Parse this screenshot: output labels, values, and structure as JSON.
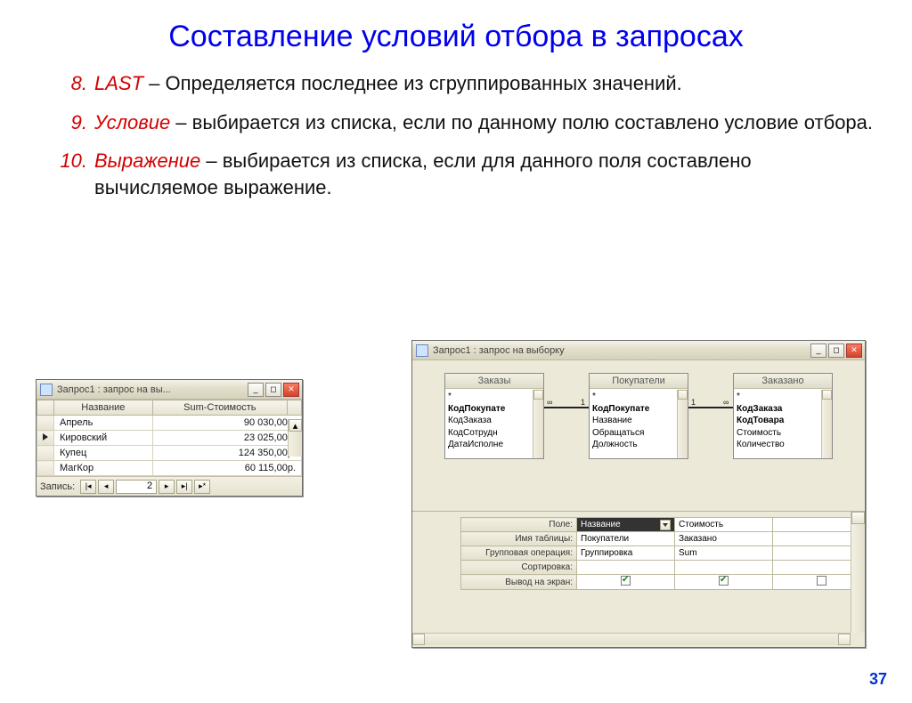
{
  "slide": {
    "title": "Составление условий отбора в запросах",
    "page_number": "37",
    "bullets": [
      {
        "num": "8.",
        "head": "LAST",
        "text": " –  Определяется последнее из сгруппированных значений."
      },
      {
        "num": "9.",
        "head": "Условие",
        "text": " – выбирается из списка, если по данному полю составлено условие отбора."
      },
      {
        "num": "10.",
        "head": "Выражение",
        "text": "  – выбирается из списка, если для данного поля составлено вычисляемое выражение."
      }
    ]
  },
  "datasheet": {
    "title": "Запрос1 : запрос на вы...",
    "columns": [
      "Название",
      "Sum-Стоимость"
    ],
    "rows": [
      {
        "name": "Апрель",
        "sum": "90 030,00р."
      },
      {
        "name": "Кировский",
        "sum": "23 025,00р."
      },
      {
        "name": "Купец",
        "sum": "124 350,00р."
      },
      {
        "name": "МагКор",
        "sum": "60 115,00р."
      }
    ],
    "nav": {
      "label": "Запись:",
      "current": "2"
    }
  },
  "design": {
    "title": "Запрос1 : запрос на выборку",
    "tables": {
      "orders": {
        "title": "Заказы",
        "fields": [
          "*",
          "КодПокупате",
          "КодЗаказа",
          "КодСотрудн",
          "ДатаИсполне"
        ],
        "bold": [
          1
        ]
      },
      "customers": {
        "title": "Покупатели",
        "fields": [
          "*",
          "КодПокупате",
          "Название",
          "Обращаться",
          "Должность"
        ],
        "bold": [
          1
        ]
      },
      "ordered": {
        "title": "Заказано",
        "fields": [
          "*",
          "КодЗаказа",
          "КодТовара",
          "Стоимость",
          "Количество"
        ],
        "bold": [
          1,
          2
        ]
      }
    },
    "relations": {
      "left_inf": "∞",
      "left_one": "1",
      "right_one": "1",
      "right_inf": "∞"
    },
    "qbe": {
      "labels": [
        "Поле:",
        "Имя таблицы:",
        "Групповая операция:",
        "Сортировка:",
        "Вывод на экран:"
      ],
      "cols": [
        {
          "field": "Название",
          "table": "Покупатели",
          "group": "Группировка",
          "sort": "",
          "show": true
        },
        {
          "field": "Стоимость",
          "table": "Заказано",
          "group": "Sum",
          "sort": "",
          "show": true
        }
      ]
    }
  }
}
